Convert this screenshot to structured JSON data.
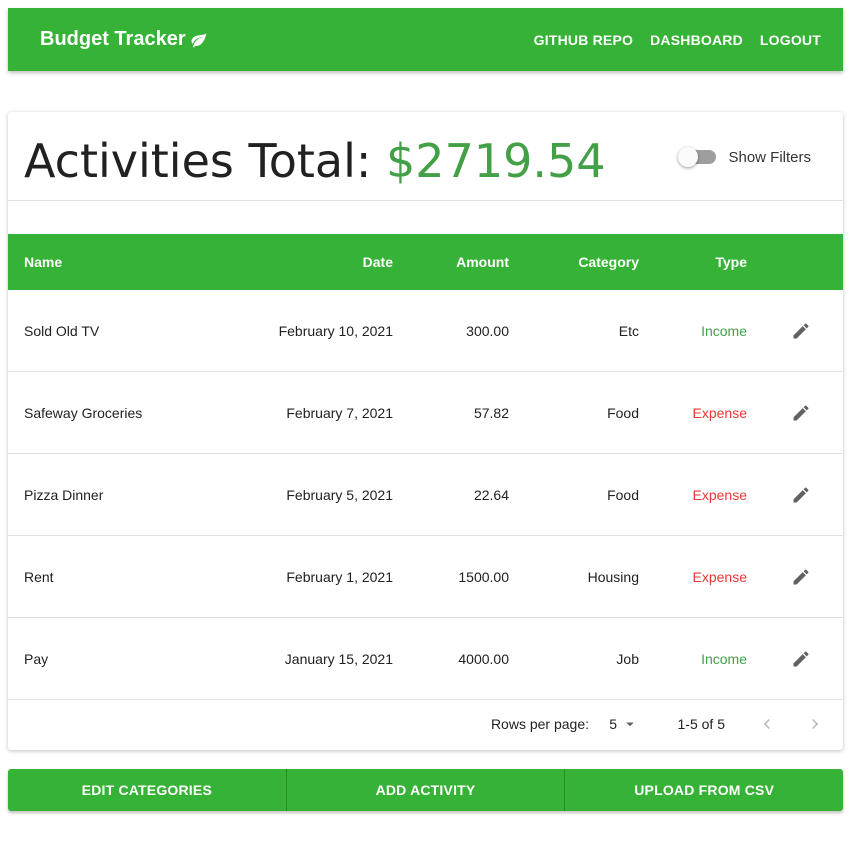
{
  "appbar": {
    "title": "Budget Tracker",
    "logo_icon": "leaf-icon",
    "nav": [
      "GITHUB REPO",
      "DASHBOARD",
      "LOGOUT"
    ]
  },
  "summary": {
    "label": "Activities Total: ",
    "amount": "$2719.54",
    "filters_label": "Show Filters",
    "filters_on": false
  },
  "table": {
    "headers": {
      "name": "Name",
      "date": "Date",
      "amount": "Amount",
      "category": "Category",
      "type": "Type"
    },
    "rows": [
      {
        "name": "Sold Old TV",
        "date": "February 10, 2021",
        "amount": "300.00",
        "category": "Etc",
        "type": "Income"
      },
      {
        "name": "Safeway Groceries",
        "date": "February 7, 2021",
        "amount": "57.82",
        "category": "Food",
        "type": "Expense"
      },
      {
        "name": "Pizza Dinner",
        "date": "February 5, 2021",
        "amount": "22.64",
        "category": "Food",
        "type": "Expense"
      },
      {
        "name": "Rent",
        "date": "February 1, 2021",
        "amount": "1500.00",
        "category": "Housing",
        "type": "Expense"
      },
      {
        "name": "Pay",
        "date": "January 15, 2021",
        "amount": "4000.00",
        "category": "Job",
        "type": "Income"
      }
    ]
  },
  "pagination": {
    "rows_per_page_label": "Rows per page:",
    "rows_per_page": "5",
    "range": "1-5 of 5"
  },
  "actions": {
    "edit_categories": "EDIT CATEGORIES",
    "add_activity": "ADD ACTIVITY",
    "upload_csv": "UPLOAD FROM CSV"
  },
  "colors": {
    "primary": "#36b336",
    "income": "#43a047",
    "expense": "#e53935"
  }
}
